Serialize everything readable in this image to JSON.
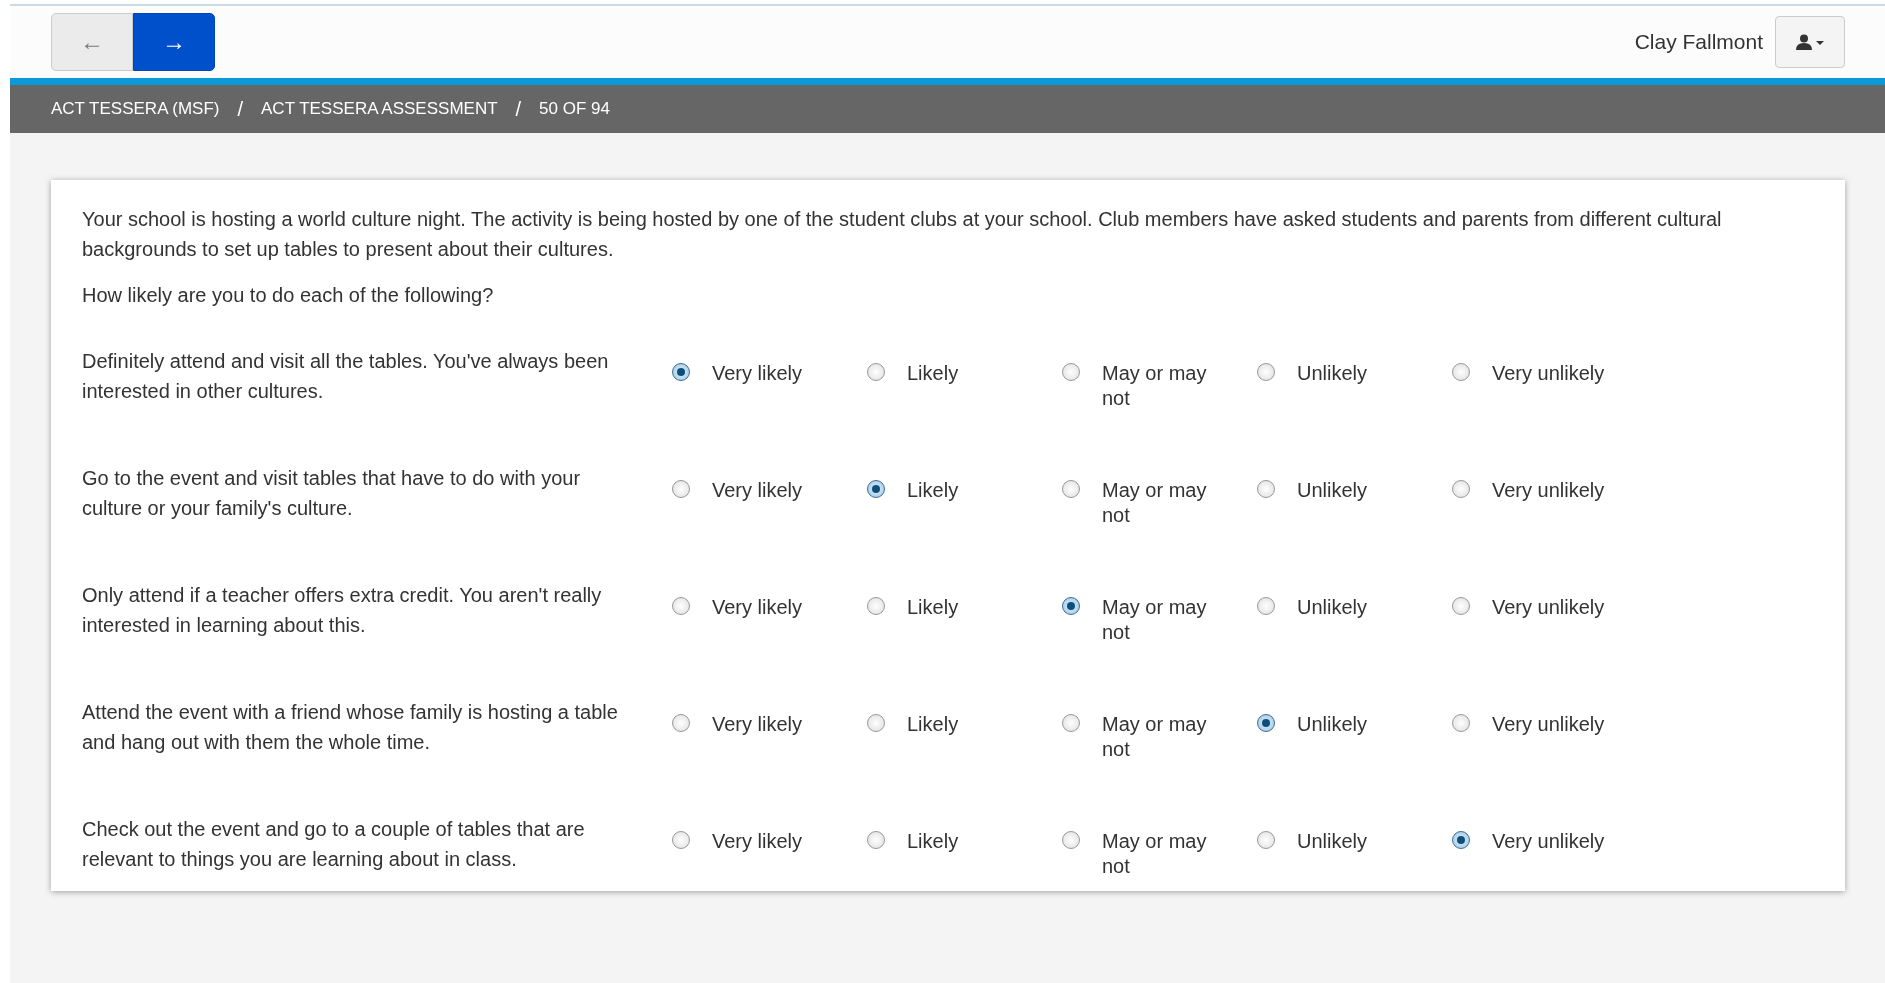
{
  "nav": {
    "back_button": {
      "label": "←",
      "selected": false
    },
    "forward_button": {
      "label": "→",
      "selected": true
    }
  },
  "user": {
    "name": "Clay Fallmont"
  },
  "breadcrumbs": [
    "ACT TESSERA (MSF)",
    "/",
    "ACT TESSERA ASSESSMENT",
    "/",
    "50 OF 94"
  ],
  "intro": "Your school is hosting a world culture night. The activity is being hosted by one of the student clubs at your school. Club members have asked students and parents from different cultural backgrounds to set up tables to present about their cultures.",
  "prompt": "How likely are you to do each of the following?",
  "items": [
    {
      "statement": "Definitely attend and visit all the tables. You've always been interested in other cultures.",
      "options": [
        {
          "label": "Very likely",
          "selected": true
        },
        {
          "label": "Likely",
          "selected": false
        },
        {
          "label": "May or may not",
          "selected": false
        },
        {
          "label": "Unlikely",
          "selected": false
        },
        {
          "label": "Very unlikely",
          "selected": false
        }
      ]
    },
    {
      "statement": "Go to the event and visit tables that have to do with your culture or your family's culture.",
      "options": [
        {
          "label": "Very likely",
          "selected": false
        },
        {
          "label": "Likely",
          "selected": true
        },
        {
          "label": "May or may not",
          "selected": false
        },
        {
          "label": "Unlikely",
          "selected": false
        },
        {
          "label": "Very unlikely",
          "selected": false
        }
      ]
    },
    {
      "statement": "Only attend if a teacher offers extra credit. You aren't really interested in learning about this.",
      "options": [
        {
          "label": "Very likely",
          "selected": false
        },
        {
          "label": "Likely",
          "selected": false
        },
        {
          "label": "May or may not",
          "selected": true
        },
        {
          "label": "Unlikely",
          "selected": false
        },
        {
          "label": "Very unlikely",
          "selected": false
        }
      ]
    },
    {
      "statement": "Attend the event with a friend whose family is hosting a table and hang out with them the whole time.",
      "options": [
        {
          "label": "Very likely",
          "selected": false
        },
        {
          "label": "Likely",
          "selected": false
        },
        {
          "label": "May or may not",
          "selected": false
        },
        {
          "label": "Unlikely",
          "selected": true
        },
        {
          "label": "Very unlikely",
          "selected": false
        }
      ]
    },
    {
      "statement": "Check out the event and go to a couple of tables that are relevant to things you are learning about in class.",
      "options": [
        {
          "label": "Very likely",
          "selected": false
        },
        {
          "label": "Likely",
          "selected": false
        },
        {
          "label": "May or may not",
          "selected": false
        },
        {
          "label": "Unlikely",
          "selected": false
        },
        {
          "label": "Very unlikely",
          "selected": true
        }
      ]
    }
  ]
}
